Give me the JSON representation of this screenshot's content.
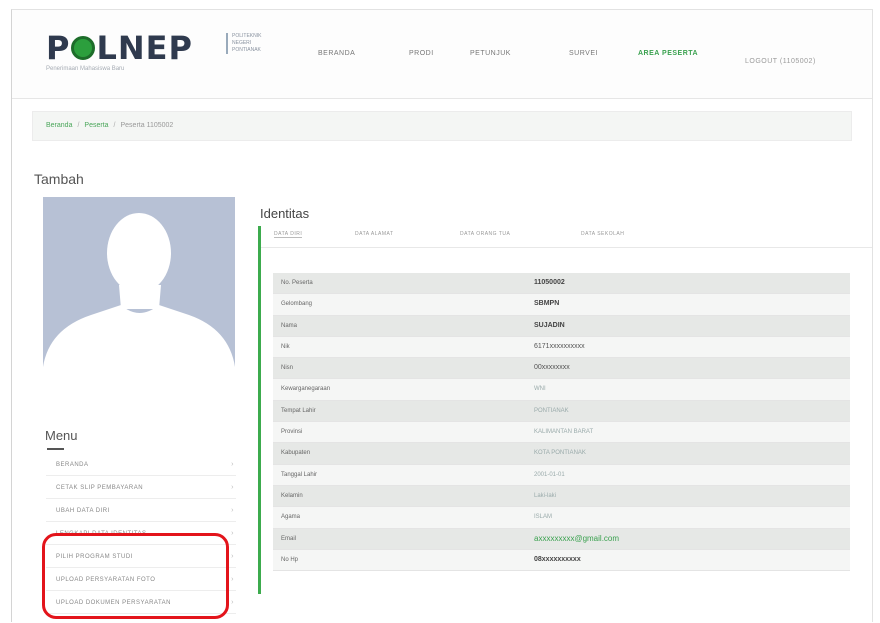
{
  "header": {
    "logo_text_1": "P",
    "logo_text_2": "LNEP",
    "logo_side": [
      "POLITEKNIK",
      "NEGERI",
      "PONTIANAK"
    ],
    "logo_sub": "Penerimaan Mahasiswa Baru",
    "nav": [
      "BERANDA",
      "PRODI",
      "PETUNJUK",
      "SURVEI",
      "AREA PESERTA"
    ],
    "logout": "LOGOUT (1105002)"
  },
  "breadcrumb": {
    "items": [
      "Beranda",
      "Peserta",
      "Peserta 1105002"
    ]
  },
  "sidebar": {
    "tambah": "Tambah",
    "menu_title": "Menu",
    "items": [
      "BERANDA",
      "CETAK SLIP PEMBAYARAN",
      "UBAH DATA DIRI",
      "LENGKAPI DATA IDENTITAS",
      "PILIH PROGRAM STUDI",
      "UPLOAD PERSYARATAN FOTO",
      "UPLOAD DOKUMEN PERSYARATAN"
    ],
    "chevron": "›"
  },
  "identitas": {
    "title": "Identitas",
    "tabs": [
      "DATA DIRI",
      "DATA ALAMAT",
      "DATA ORANG TUA",
      "DATA SEKOLAH"
    ],
    "rows": [
      {
        "label": "No. Peserta",
        "value": "11050002"
      },
      {
        "label": "Gelombang",
        "value": "SBMPN"
      },
      {
        "label": "Nama",
        "value": "SUJADIN"
      },
      {
        "label": "Nik",
        "value": "6171xxxxxxxxxx"
      },
      {
        "label": "Nisn",
        "value": "00xxxxxxxx"
      },
      {
        "label": "Kewarganegaraan",
        "value": "WNI"
      },
      {
        "label": "Tempat Lahir",
        "value": "PONTIANAK"
      },
      {
        "label": "Provinsi",
        "value": "KALIMANTAN BARAT"
      },
      {
        "label": "Kabupaten",
        "value": "KOTA PONTIANAK"
      },
      {
        "label": "Tanggal Lahir",
        "value": "2001-01-01"
      },
      {
        "label": "Kelamin",
        "value": "Laki-laki"
      },
      {
        "label": "Agama",
        "value": "ISLAM"
      },
      {
        "label": "Email",
        "value": "axxxxxxxxx@gmail.com"
      },
      {
        "label": "No Hp",
        "value": "08xxxxxxxxxx"
      }
    ]
  },
  "colors": {
    "accent": "#3aa14f",
    "highlight": "#e3141b",
    "avatar_bg": "#b7c1d5"
  }
}
